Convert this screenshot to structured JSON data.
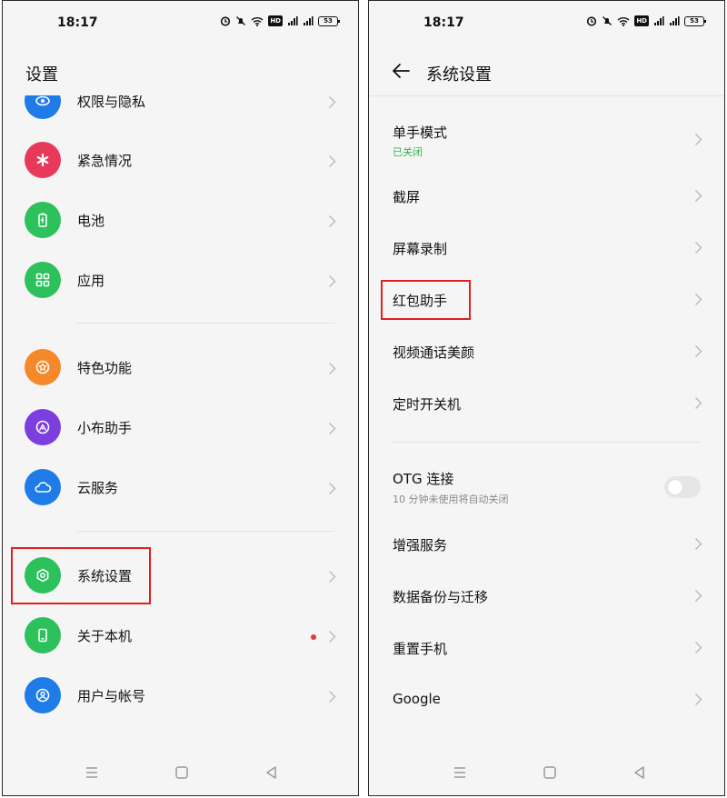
{
  "left": {
    "status": {
      "time": "18:17",
      "battery": "53",
      "network_badge": "HD"
    },
    "header": {
      "title": "设置"
    },
    "items": [
      {
        "label": "权限与隐私",
        "icon": "privacy-icon",
        "color": "#1e7be8"
      },
      {
        "label": "紧急情况",
        "icon": "sos-icon",
        "color": "#e9395a"
      },
      {
        "label": "电池",
        "icon": "battery-icon",
        "color": "#2cc15a"
      },
      {
        "label": "应用",
        "icon": "apps-icon",
        "color": "#2cc15a"
      },
      {
        "label": "特色功能",
        "icon": "star-icon",
        "color": "#f5892a"
      },
      {
        "label": "小布助手",
        "icon": "assistant-icon",
        "color": "#7b3fe0"
      },
      {
        "label": "云服务",
        "icon": "cloud-icon",
        "color": "#1e7be8"
      },
      {
        "label": "系统设置",
        "icon": "system-settings-icon",
        "color": "#2cc15a"
      },
      {
        "label": "关于本机",
        "icon": "phone-icon",
        "color": "#2cc15a",
        "badge": "red-dot"
      },
      {
        "label": "用户与帐号",
        "icon": "user-icon",
        "color": "#1e7be8"
      }
    ]
  },
  "right": {
    "status": {
      "time": "18:17",
      "battery": "53",
      "network_badge": "HD"
    },
    "header": {
      "title": "系统设置"
    },
    "items": [
      {
        "label": "单手模式",
        "sub": "已关闭"
      },
      {
        "label": "截屏"
      },
      {
        "label": "屏幕录制"
      },
      {
        "label": "红包助手"
      },
      {
        "label": "视频通话美颜"
      },
      {
        "label": "定时开关机"
      },
      {
        "label": "OTG 连接",
        "sub": "10 分钟未使用将自动关闭",
        "toggle": false
      },
      {
        "label": "增强服务"
      },
      {
        "label": "数据备份与迁移"
      },
      {
        "label": "重置手机"
      },
      {
        "label": "Google"
      }
    ]
  },
  "colors": {
    "highlight": "#e02020",
    "accent_green": "#2fb34b"
  }
}
